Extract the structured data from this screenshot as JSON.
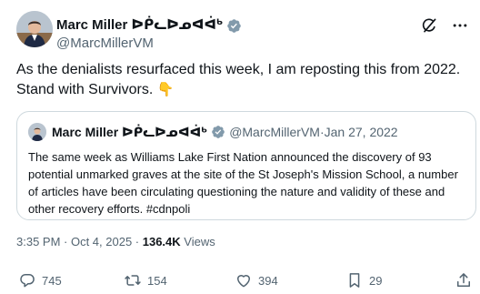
{
  "post": {
    "author_name": "Marc Miller ᐅᑮᓚᐅᓄᐊᐋᒃ",
    "author_handle": "@MarcMillerVM",
    "text_line1": "As the denialists resurfaced this week, I am reposting this from 2022.",
    "text_line2": "Stand with Survivors.",
    "emoji": "👇",
    "time": "3:35 PM · Oct 4, 2025 · ",
    "views_count": "136.4K",
    "views_label": " Views"
  },
  "quote": {
    "author_name": "Marc Miller ᐅᑮᓚᐅᓄᐊᐋᒃ",
    "author_handle": "@MarcMillerVM",
    "separator": " · ",
    "date": "Jan 27, 2022",
    "text": "The same week as Williams Lake First Nation announced the discovery of 93 potential unmarked graves at the site of the St Joseph's Mission School, a number of articles have been circulating questioning the nature and validity of these and other recovery efforts. #cdnpoli"
  },
  "actions": {
    "replies": "745",
    "reposts": "154",
    "likes": "394",
    "bookmarks": "29"
  },
  "icons": [
    "grok-icon",
    "more-icon",
    "verified-icon",
    "reply-icon",
    "repost-icon",
    "like-icon",
    "bookmark-icon",
    "share-icon"
  ],
  "colors": {
    "text": "#0f1419",
    "muted": "#536471",
    "verified": "#829aab",
    "border": "#cfd9de"
  }
}
